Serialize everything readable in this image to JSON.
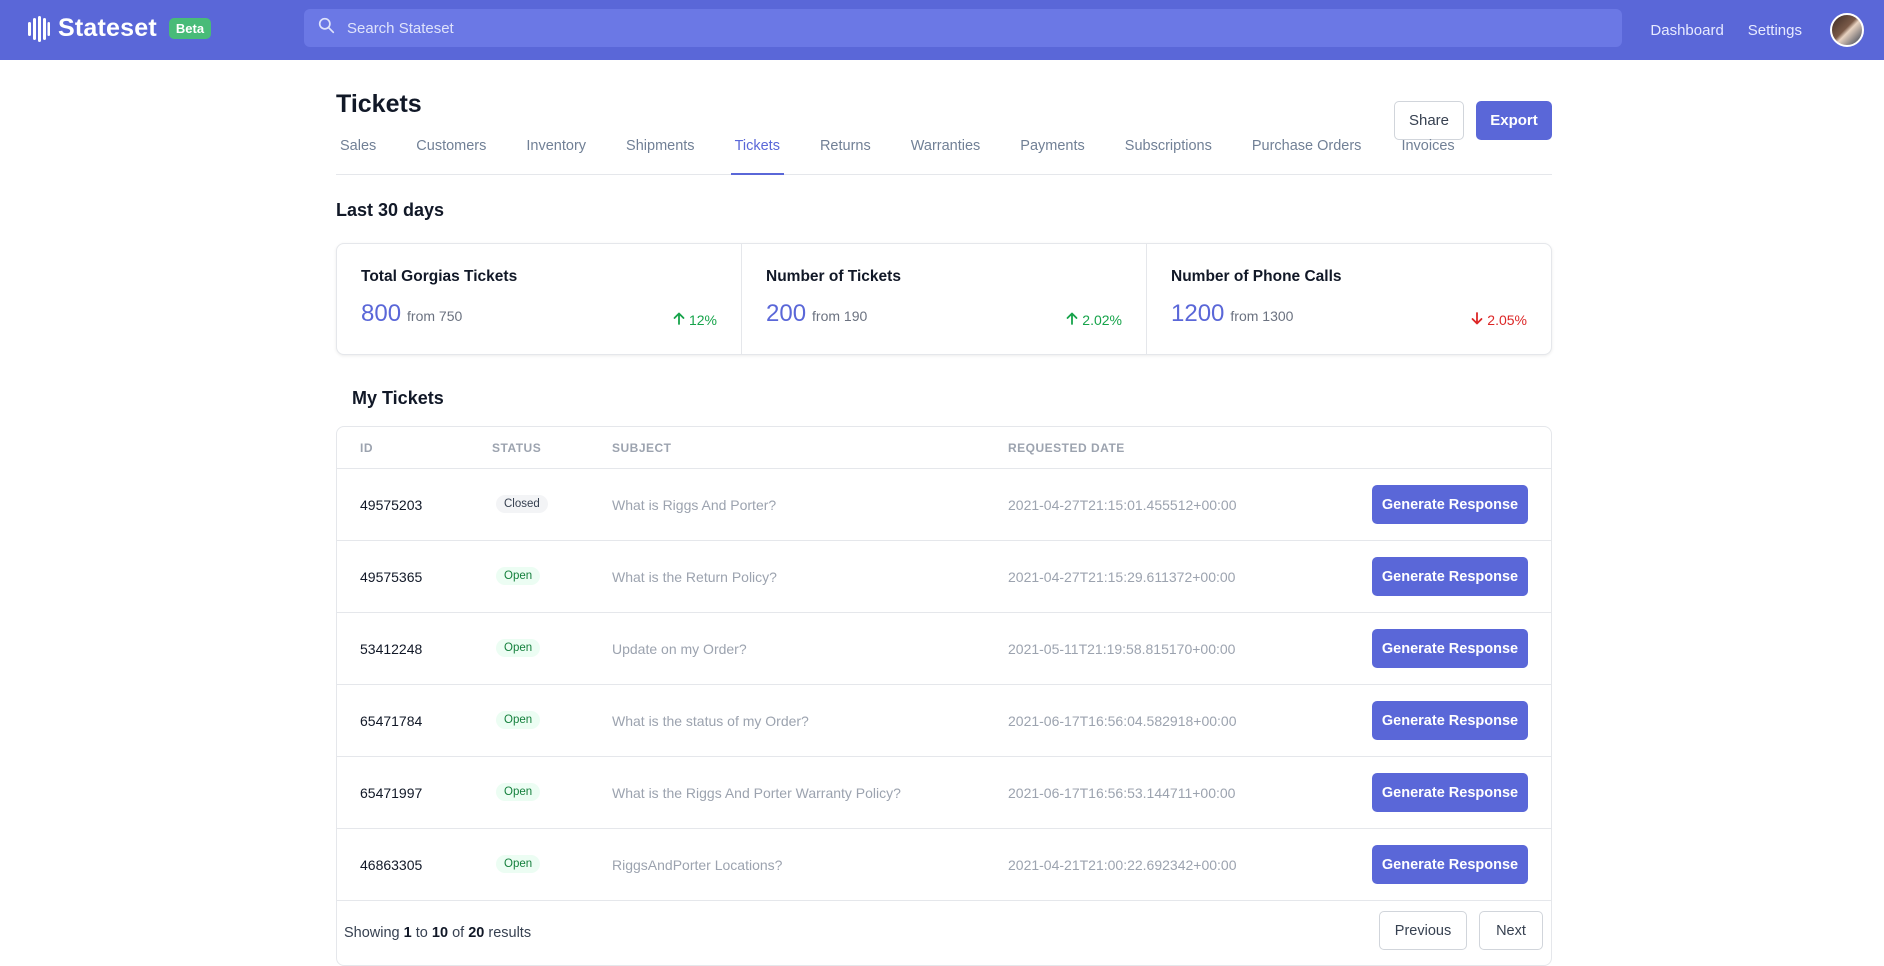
{
  "app": {
    "name": "Stateset",
    "badge": "Beta",
    "search_placeholder": "Search Stateset",
    "nav": [
      "Dashboard",
      "Settings"
    ],
    "accent_color": "#5a67d8"
  },
  "page": {
    "title": "Tickets",
    "share_label": "Share",
    "export_label": "Export",
    "tabs": [
      "Sales",
      "Customers",
      "Inventory",
      "Shipments",
      "Tickets",
      "Returns",
      "Warranties",
      "Payments",
      "Subscriptions",
      "Purchase Orders",
      "Invoices"
    ],
    "active_tab": "Tickets",
    "period_title": "Last 30 days"
  },
  "stats": [
    {
      "label": "Total Gorgias Tickets",
      "value": "800",
      "from": "from 750",
      "change": "12%",
      "direction": "up"
    },
    {
      "label": "Number of Tickets",
      "value": "200",
      "from": "from 190",
      "change": "2.02%",
      "direction": "up"
    },
    {
      "label": "Number of Phone Calls",
      "value": "1200",
      "from": "from 1300",
      "change": "2.05%",
      "direction": "down"
    }
  ],
  "tickets": {
    "title": "My Tickets",
    "columns": {
      "id": "ID",
      "status": "Status",
      "subject": "Subject",
      "date": "Requested Date"
    },
    "action_label": "Generate Response",
    "rows": [
      {
        "id": "49575203",
        "status": "Closed",
        "subject": "What is Riggs And Porter?",
        "date": "2021-04-27T21:15:01.455512+00:00"
      },
      {
        "id": "49575365",
        "status": "Open",
        "subject": "What is the Return Policy?",
        "date": "2021-04-27T21:15:29.611372+00:00"
      },
      {
        "id": "53412248",
        "status": "Open",
        "subject": "Update on my Order?",
        "date": "2021-05-11T21:19:58.815170+00:00"
      },
      {
        "id": "65471784",
        "status": "Open",
        "subject": "What is the status of my Order?",
        "date": "2021-06-17T16:56:04.582918+00:00"
      },
      {
        "id": "65471997",
        "status": "Open",
        "subject": "What is the Riggs And Porter Warranty Policy?",
        "date": "2021-06-17T16:56:53.144711+00:00"
      },
      {
        "id": "46863305",
        "status": "Open",
        "subject": "RiggsAndPorter Locations?",
        "date": "2021-04-21T21:00:22.692342+00:00"
      }
    ]
  },
  "pagination": {
    "showing_prefix": "Showing",
    "from": "1",
    "to_word": "to",
    "to": "10",
    "of_word": "of",
    "total": "20",
    "suffix": "results",
    "previous_label": "Previous",
    "next_label": "Next"
  }
}
